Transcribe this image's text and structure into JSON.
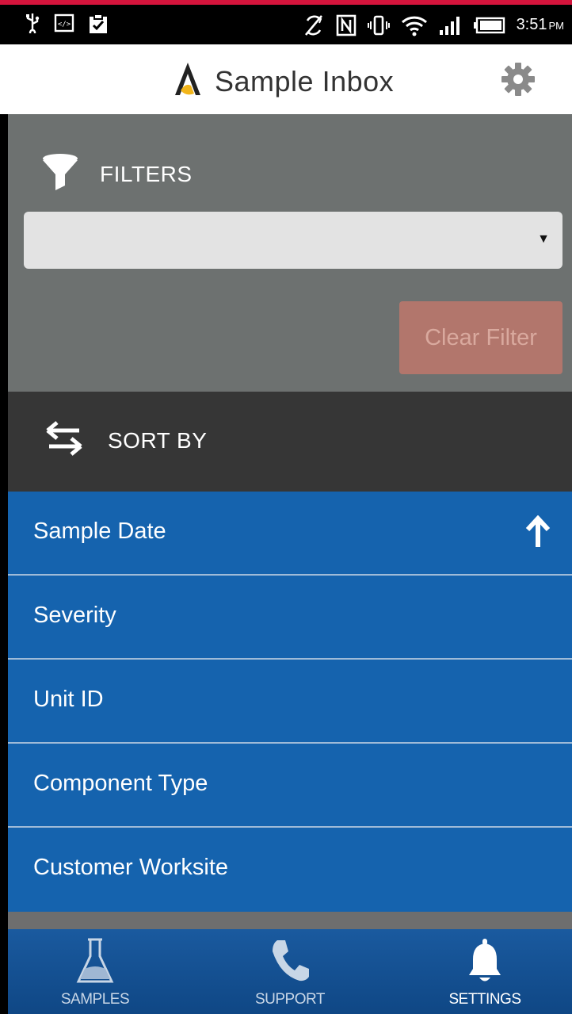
{
  "status_bar": {
    "time": "3:51",
    "ampm": "PM",
    "left_icons": [
      "usb-icon",
      "code-icon",
      "clipboard-check-icon"
    ],
    "right_icons": [
      "sync-off-icon",
      "nfc-icon",
      "vibrate-icon",
      "wifi-icon",
      "signal-icon",
      "battery-icon"
    ]
  },
  "app_bar": {
    "title": "Sample Inbox",
    "logo_icon": "flask-logo-icon",
    "settings_icon": "gear-icon"
  },
  "filters": {
    "header": "FILTERS",
    "icon": "funnel-icon",
    "select": {
      "value": "",
      "caret": "▼"
    },
    "clear_button": "Clear Filter"
  },
  "sort_by": {
    "header": "SORT BY",
    "icon": "swap-arrows-icon",
    "items": [
      {
        "label": "Sample Date",
        "direction_icon": "arrow-up-icon"
      },
      {
        "label": "Severity"
      },
      {
        "label": "Unit ID"
      },
      {
        "label": "Component Type"
      },
      {
        "label": "Customer Worksite"
      }
    ]
  },
  "bottom_nav": {
    "items": [
      {
        "label": "SAMPLES",
        "icon": "flask-icon",
        "active": false
      },
      {
        "label": "SUPPORT",
        "icon": "phone-icon",
        "active": false
      },
      {
        "label": "SETTINGS",
        "icon": "bell-icon",
        "active": true
      }
    ]
  },
  "colors": {
    "accent_red": "#d4143c",
    "filters_bg": "#6d7170",
    "sortby_bg": "#363636",
    "list_blue": "#1563ae",
    "clear_btn": "#b2766c",
    "nav_blue": "#1a5a9f"
  }
}
